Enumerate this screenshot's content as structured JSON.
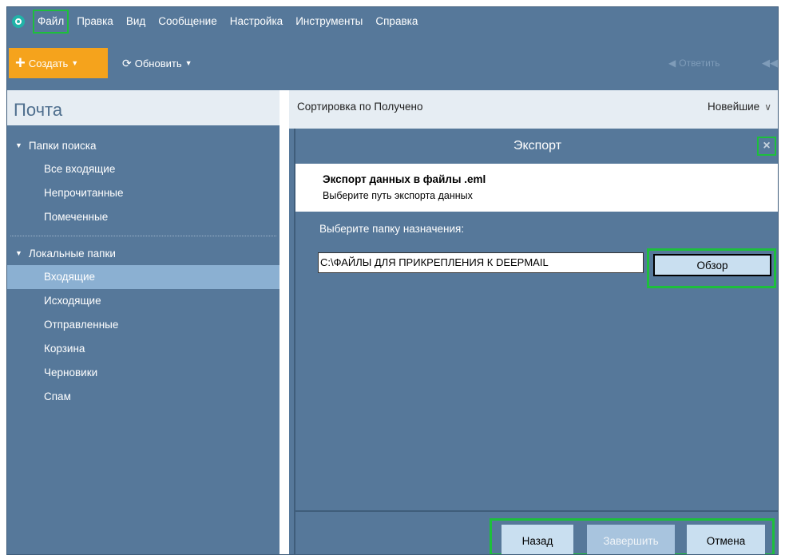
{
  "menu": {
    "items": [
      "Файл",
      "Правка",
      "Вид",
      "Сообщение",
      "Настройка",
      "Инструменты",
      "Справка"
    ]
  },
  "toolbar": {
    "create_label": "Создать",
    "refresh_label": "Обновить",
    "reply_label": "Ответить"
  },
  "sidebar": {
    "title": "Почта",
    "search_section": "Папки поиска",
    "search_folders": [
      "Все входящие",
      "Непрочитанные",
      "Помеченные"
    ],
    "local_section": "Локальные папки",
    "local_folders": [
      "Входящие",
      "Исходящие",
      "Отправленные",
      "Корзина",
      "Черновики",
      "Спам"
    ],
    "selected_folder": "Входящие"
  },
  "sort": {
    "label": "Сортировка по Получено",
    "order": "Новейшие"
  },
  "dialog": {
    "title": "Экспорт",
    "heading": "Экспорт данных в файлы .eml",
    "subheading": "Выберите путь экспорта данных",
    "dest_label": "Выберите папку назначения:",
    "path_value": "C:\\ФАЙЛЫ ДЛЯ ПРИКРЕПЛЕНИЯ К DEEPMAIL",
    "browse_label": "Обзор",
    "back_label": "Назад",
    "finish_label": "Завершить",
    "cancel_label": "Отмена"
  },
  "colors": {
    "background": "#56789a",
    "accent_orange": "#f5a31c",
    "highlight_green": "#1dbf3c",
    "selected_folder": "#8bb0d2"
  }
}
